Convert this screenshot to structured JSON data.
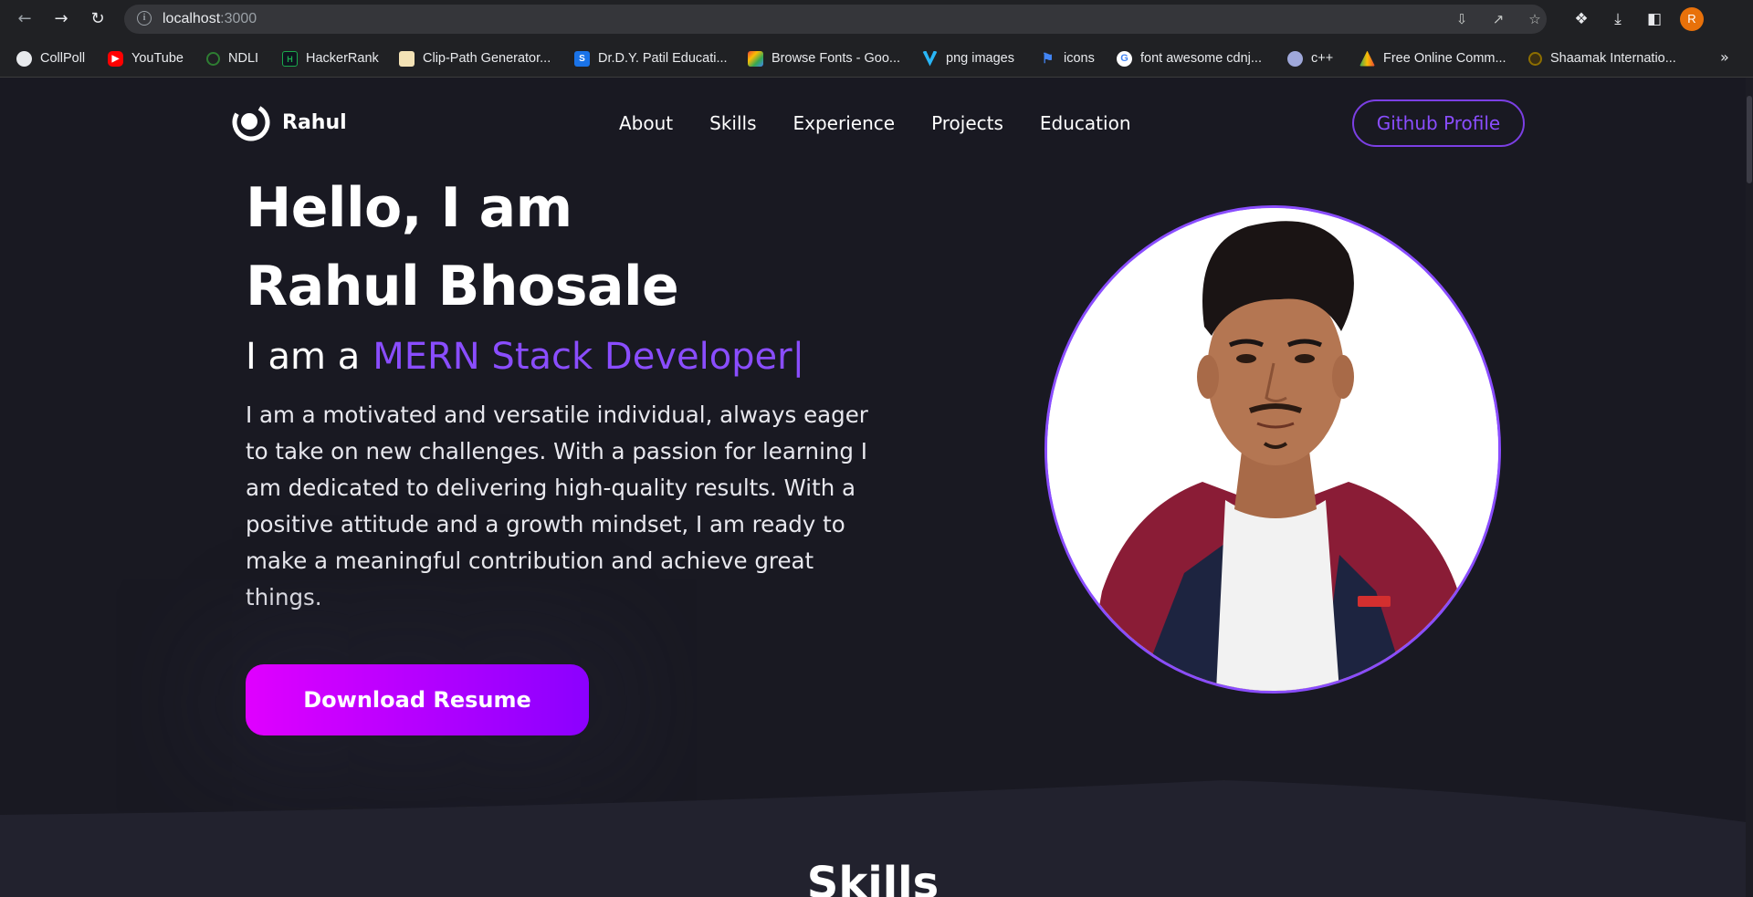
{
  "browser": {
    "url_host": "localhost",
    "url_port": ":3000",
    "profile_initial": "R",
    "bookmarks": [
      {
        "label": "CollPoll",
        "icon": "globe-icon",
        "color": "#e8eaed"
      },
      {
        "label": "YouTube",
        "icon": "youtube-icon",
        "color": "#ff0000"
      },
      {
        "label": "NDLI",
        "icon": "ndli-icon",
        "color": "#2e7d32"
      },
      {
        "label": "HackerRank",
        "icon": "hackerrank-icon",
        "color": "#1ba94c"
      },
      {
        "label": "Clip-Path Generator...",
        "icon": "clippath-icon",
        "color": "#c49a3a"
      },
      {
        "label": "Dr.D.Y. Patil Educati...",
        "icon": "s-icon",
        "color": "#1a73e8"
      },
      {
        "label": "Browse Fonts - Goo...",
        "icon": "google-fonts-icon",
        "color": "#fbbc04"
      },
      {
        "label": "png images",
        "icon": "png-icon",
        "color": "#29b6f6"
      },
      {
        "label": "icons",
        "icon": "flag-icon",
        "color": "#4285f4"
      },
      {
        "label": "font awesome cdnj...",
        "icon": "google-icon",
        "color": "#ffffff"
      },
      {
        "label": "c++",
        "icon": "cpp-icon",
        "color": "#9fa8da"
      },
      {
        "label": "Free Online Comm...",
        "icon": "drive-icon",
        "color": "#34a853"
      },
      {
        "label": "Shaamak Internatio...",
        "icon": "shaamak-icon",
        "color": "#8d6e00"
      }
    ],
    "more_glyph": "»"
  },
  "header": {
    "logo_text": "Rahul",
    "nav": [
      "About",
      "Skills",
      "Experience",
      "Projects",
      "Education"
    ],
    "github_button": "Github Profile"
  },
  "hero": {
    "title_line1": "Hello, I am",
    "title_line2": "Rahul Bhosale",
    "role_prefix": "I am a",
    "role": "MERN Stack Developer",
    "caret": "|",
    "bio": "I am a motivated and versatile individual, always eager to take on new challenges. With a passion for learning I am dedicated to delivering high-quality results. With a positive attitude and a growth mindset, I am ready to make a meaningful contribution and achieve great things.",
    "resume_button": "Download Resume"
  },
  "skills": {
    "title": "Skills"
  },
  "colors": {
    "accent": "#8a4dff",
    "background": "#191922",
    "button_gradient_start": "#e000ff",
    "button_gradient_end": "#8b00ff"
  }
}
